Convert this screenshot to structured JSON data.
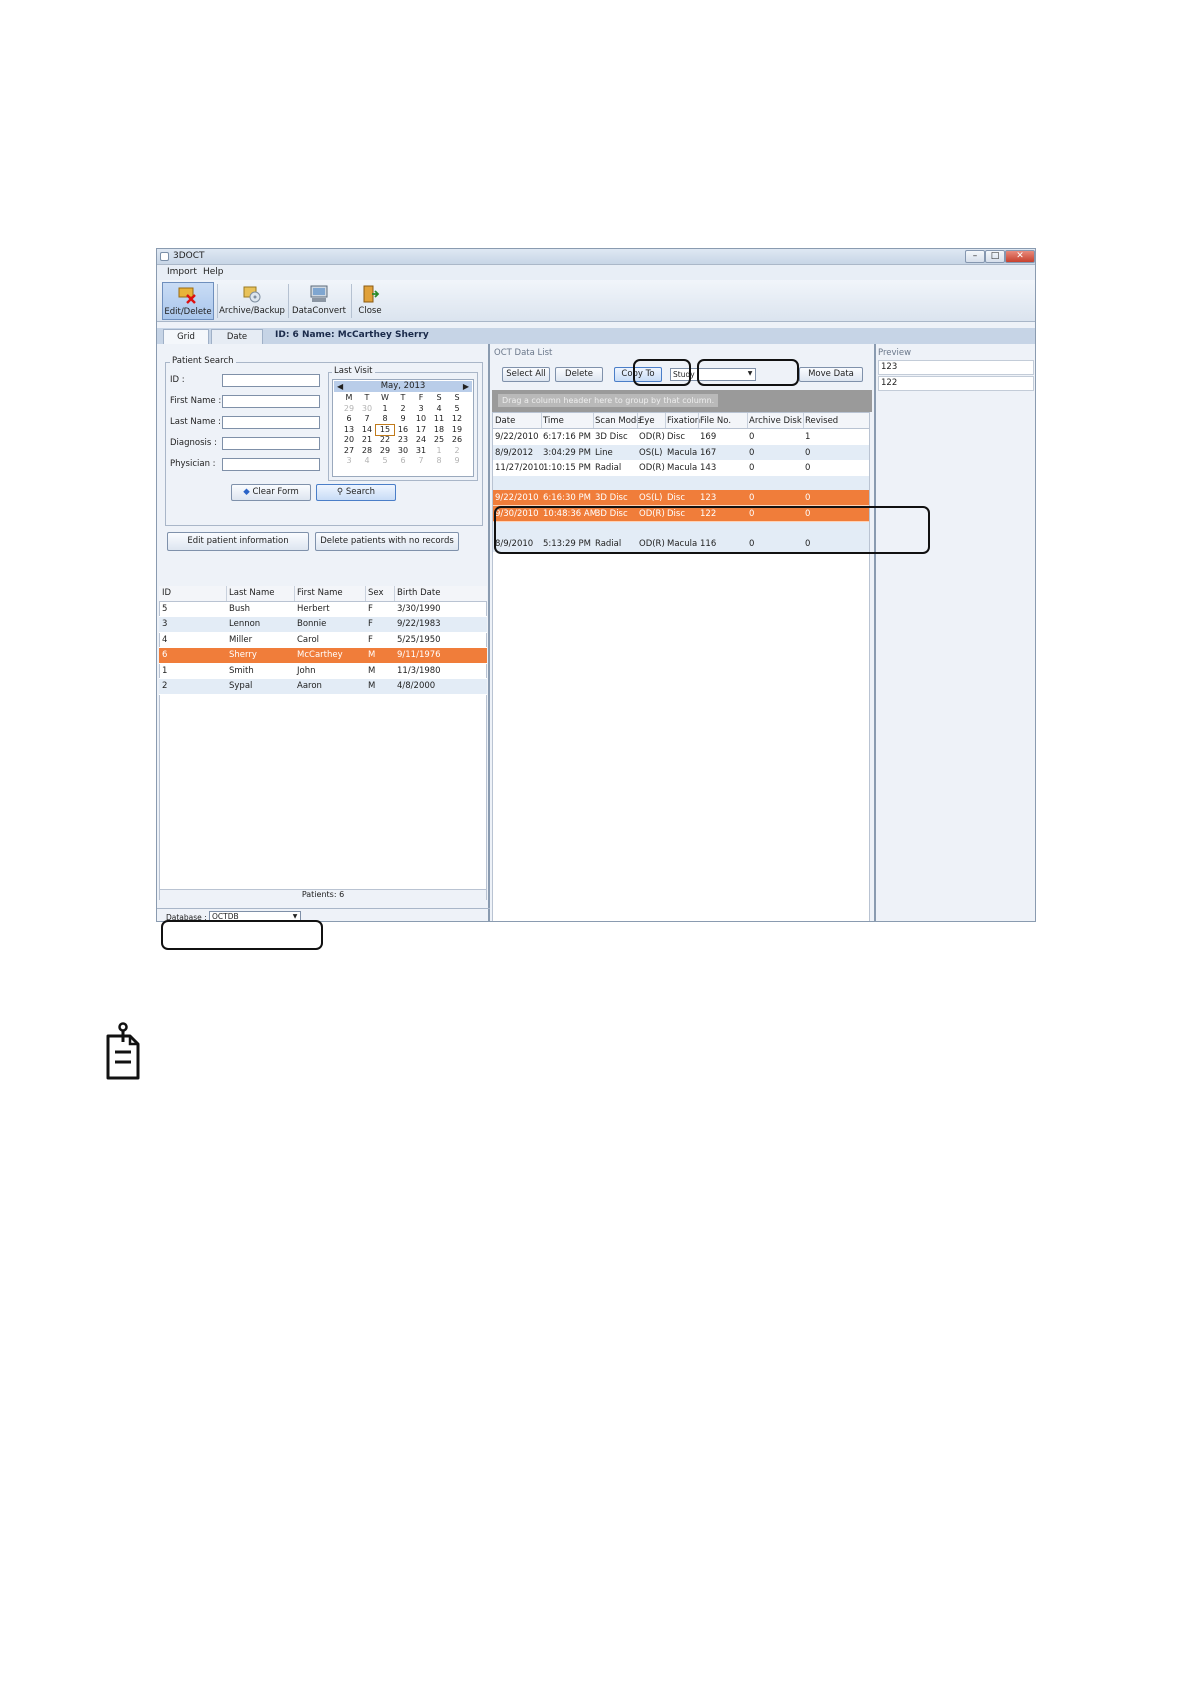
{
  "window": {
    "title": "3DOCT"
  },
  "menu": [
    "Import",
    "Help"
  ],
  "toolbar": {
    "edit_delete": "Edit/Delete",
    "archive_backup": "Archive/Backup",
    "data_convert": "DataConvert",
    "close": "Close"
  },
  "tabs": [
    "Grid",
    "Date"
  ],
  "patient_header": "ID: 6   Name: McCarthey Sherry",
  "search": {
    "legend": "Patient Search",
    "id_label": "ID :",
    "first_name_label": "First Name :",
    "last_name_label": "Last Name :",
    "diagnosis_label": "Diagnosis :",
    "physician_label": "Physician :",
    "clear_form": "Clear Form",
    "search_button": "Search"
  },
  "last_visit": {
    "legend": "Last Visit",
    "month": "May, 2013",
    "weekdays": [
      "M",
      "T",
      "W",
      "T",
      "F",
      "S",
      "S"
    ],
    "weeks": [
      [
        "29",
        "30",
        "1",
        "2",
        "3",
        "4",
        "5"
      ],
      [
        "6",
        "7",
        "8",
        "9",
        "10",
        "11",
        "12"
      ],
      [
        "13",
        "14",
        "15",
        "16",
        "17",
        "18",
        "19"
      ],
      [
        "20",
        "21",
        "22",
        "23",
        "24",
        "25",
        "26"
      ],
      [
        "27",
        "28",
        "29",
        "30",
        "31",
        "1",
        "2"
      ],
      [
        "3",
        "4",
        "5",
        "6",
        "7",
        "8",
        "9"
      ]
    ],
    "today": "15"
  },
  "actions": {
    "edit_patient": "Edit patient information",
    "delete_no_records": "Delete patients with no records"
  },
  "patients": {
    "columns": [
      "ID",
      "Last Name",
      "First Name",
      "Sex",
      "Birth Date"
    ],
    "rows": [
      [
        "5",
        "Bush",
        "Herbert",
        "F",
        "3/30/1990"
      ],
      [
        "3",
        "Lennon",
        "Bonnie",
        "F",
        "9/22/1983"
      ],
      [
        "4",
        "Miller",
        "Carol",
        "F",
        "5/25/1950"
      ],
      [
        "6",
        "Sherry",
        "McCarthey",
        "M",
        "9/11/1976"
      ],
      [
        "1",
        "Smith",
        "John",
        "M",
        "11/3/1980"
      ],
      [
        "2",
        "Sypal",
        "Aaron",
        "M",
        "4/8/2000"
      ]
    ],
    "selected_index": 3,
    "count": "Patients: 6"
  },
  "database": {
    "label": "Database :",
    "value": "OCTDB"
  },
  "oct": {
    "title": "OCT Data List",
    "select_all": "Select All",
    "delete": "Delete",
    "copy_to": "Copy To",
    "study_value": "Study",
    "move_data": "Move Data",
    "group_hint": "Drag a column header here to group by that column.",
    "columns": [
      "Date",
      "Time",
      "Scan Mode",
      "Eye",
      "Fixation",
      "File No.",
      "Archive Disk",
      "Revised"
    ],
    "rows_top": [
      [
        "9/22/2010",
        "6:17:16 PM",
        "3D Disc",
        "OD(R)",
        "Disc",
        "169",
        "0",
        "1"
      ],
      [
        "8/9/2012",
        "3:04:29 PM",
        "Line",
        "OS(L)",
        "Macula",
        "167",
        "0",
        "0"
      ],
      [
        "11/27/2010",
        "1:10:15 PM",
        "Radial",
        "OD(R)",
        "Macula",
        "143",
        "0",
        "0"
      ]
    ],
    "rows_selected": [
      [
        "9/22/2010",
        "6:16:30 PM",
        "3D Disc",
        "OS(L)",
        "Disc",
        "123",
        "0",
        "0"
      ],
      [
        "9/30/2010",
        "10:48:36 AM",
        "3D Disc",
        "OD(R)",
        "Disc",
        "122",
        "0",
        "0"
      ]
    ],
    "rows_bottom": [
      [
        "8/9/2010",
        "5:13:29 PM",
        "Radial",
        "OD(R)",
        "Macula",
        "116",
        "0",
        "0"
      ]
    ]
  },
  "preview": {
    "title": "Preview",
    "items": [
      "123",
      "122"
    ]
  },
  "colors": {
    "selection": "#f07d3a",
    "accent": "#b9cde9"
  }
}
